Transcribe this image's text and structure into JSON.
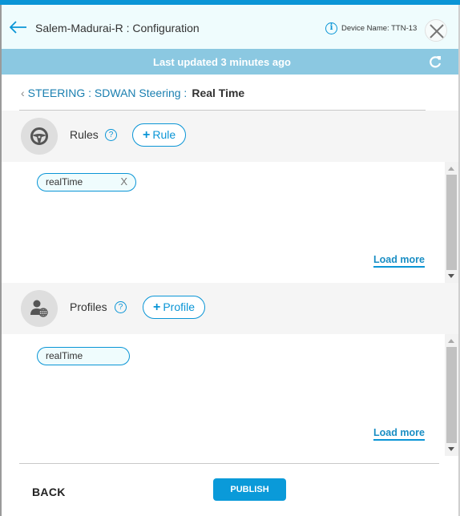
{
  "header": {
    "title": "Salem-Madurai-R : Configuration",
    "device_name": "Device Name: TTN-13",
    "back_icon": "arrow-left-icon",
    "info_icon": "info-icon",
    "close_icon": "close-icon"
  },
  "status_bar": {
    "text": "Last updated 3 minutes ago",
    "refresh_icon": "refresh-icon"
  },
  "breadcrumb": {
    "items": [
      "STEERING",
      "SDWAN Steering"
    ],
    "separator": " : ",
    "trailing": " :",
    "current": "Real Time"
  },
  "sections": {
    "rules": {
      "label": "Rules",
      "help": "?",
      "add_label": "Rule",
      "add_prefix": "+",
      "icon": "steering-wheel-icon",
      "chips": [
        {
          "label": "realTime",
          "removable": true,
          "remove_glyph": "X"
        }
      ],
      "load_more": "Load more"
    },
    "profiles": {
      "label": "Profiles",
      "help": "?",
      "add_label": "Profile",
      "add_prefix": "+",
      "icon": "user-globe-icon",
      "chips": [
        {
          "label": "realTime",
          "removable": false
        }
      ],
      "load_more": "Load more"
    }
  },
  "footer": {
    "back_label": "BACK",
    "publish_label": "PUBLISH"
  },
  "colors": {
    "accent": "#0a95d6",
    "header_bg": "#effcfd",
    "status_bg": "#8bc8e1",
    "section_bg": "#f5f5f5",
    "publish_bg": "#0a9ad9"
  }
}
